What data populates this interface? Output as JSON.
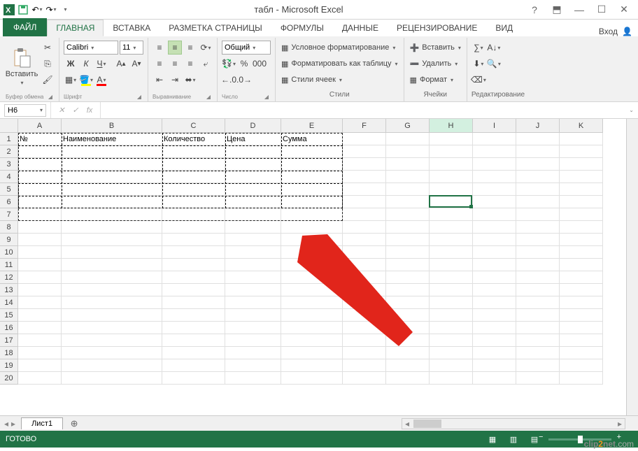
{
  "app": {
    "title": "табл - Microsoft Excel"
  },
  "qat": {
    "icons": [
      "excel",
      "save",
      "undo",
      "redo",
      "touch"
    ]
  },
  "tabs": {
    "file": "ФАЙЛ",
    "items": [
      "ГЛАВНАЯ",
      "ВСТАВКА",
      "РАЗМЕТКА СТРАНИЦЫ",
      "ФОРМУЛЫ",
      "ДАННЫЕ",
      "РЕЦЕНЗИРОВАНИЕ",
      "ВИД"
    ],
    "active": 0,
    "signin": "Вход"
  },
  "ribbon": {
    "clipboard": {
      "label": "Буфер обмена",
      "paste": "Вставить"
    },
    "font": {
      "label": "Шрифт",
      "name": "Calibri",
      "size": "11"
    },
    "align": {
      "label": "Выравнивание"
    },
    "number": {
      "label": "Число",
      "format": "Общий"
    },
    "styles": {
      "label": "Стили",
      "cond": "Условное форматирование",
      "table": "Форматировать как таблицу",
      "cell": "Стили ячеек"
    },
    "cells": {
      "label": "Ячейки",
      "insert": "Вставить",
      "delete": "Удалить",
      "format": "Формат"
    },
    "editing": {
      "label": "Редактирование"
    }
  },
  "formula_bar": {
    "name": "H6",
    "fx": "fx"
  },
  "columns": [
    {
      "l": "A",
      "w": 62
    },
    {
      "l": "B",
      "w": 144
    },
    {
      "l": "C",
      "w": 90
    },
    {
      "l": "D",
      "w": 80
    },
    {
      "l": "E",
      "w": 88
    },
    {
      "l": "F",
      "w": 62
    },
    {
      "l": "G",
      "w": 62
    },
    {
      "l": "H",
      "w": 62
    },
    {
      "l": "I",
      "w": 62
    },
    {
      "l": "J",
      "w": 62
    },
    {
      "l": "K",
      "w": 62
    }
  ],
  "rows": 20,
  "headers": [
    "№",
    "Наименование",
    "Количество",
    "Цена",
    "Сумма"
  ],
  "table": {
    "rows": 6,
    "cols": 5,
    "header_row": 1,
    "marquee_rows": 7
  },
  "active_cell": {
    "col": 7,
    "row": 6
  },
  "sheet_tabs": {
    "active": "Лист1"
  },
  "status": {
    "text": "ГОТОВО"
  },
  "watermark": {
    "a": "clip",
    "b": "2",
    "c": "net",
    "d": ".com"
  }
}
